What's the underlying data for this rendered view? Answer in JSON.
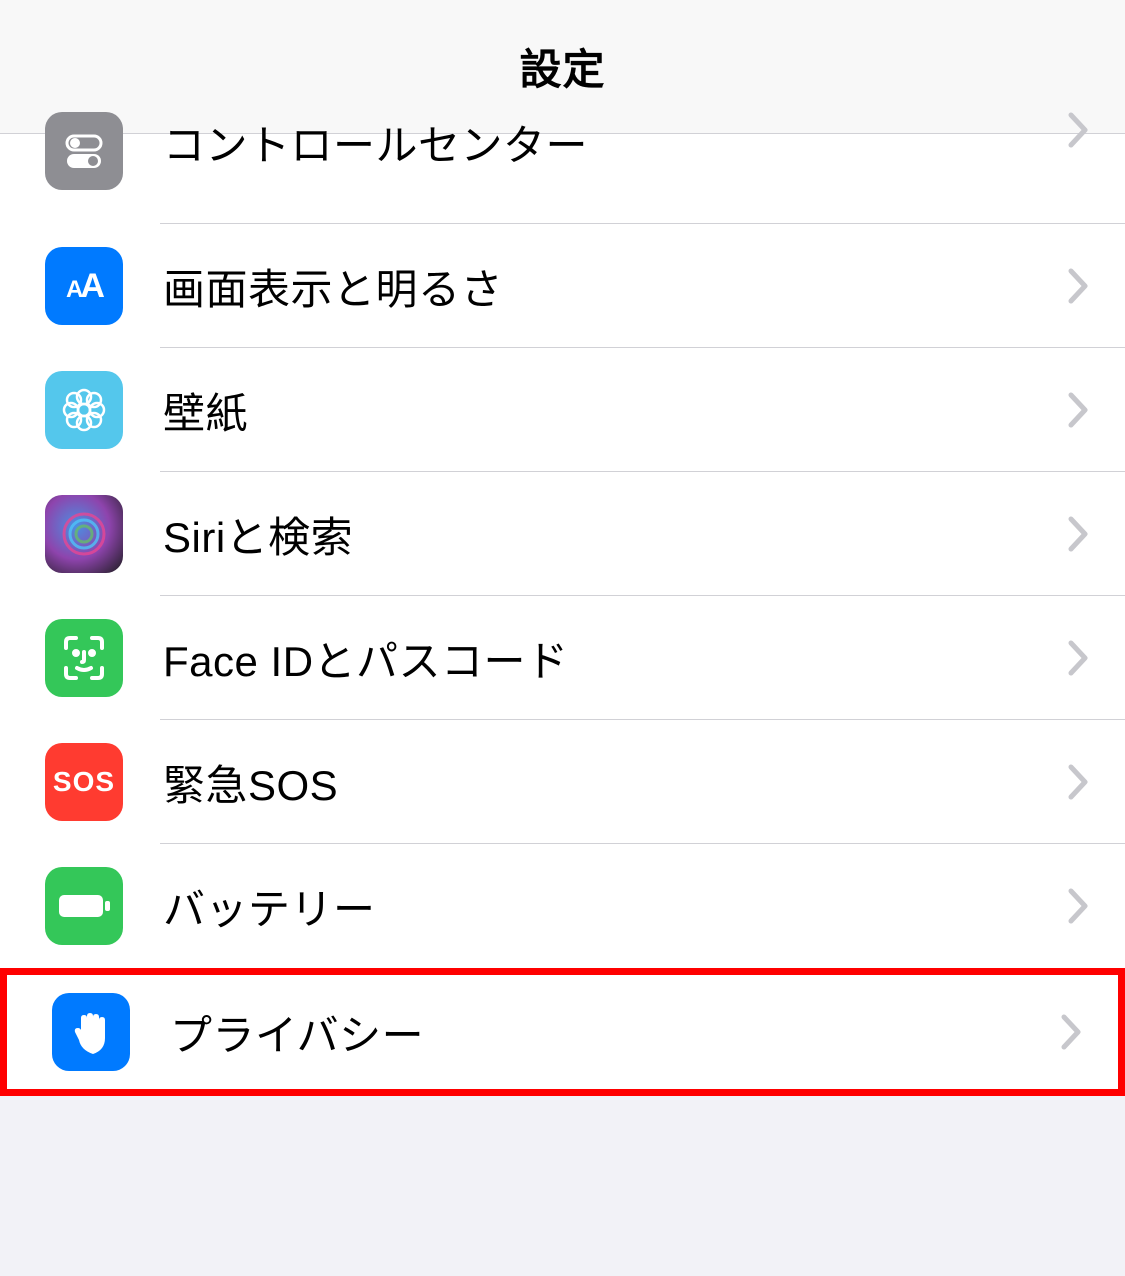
{
  "header": {
    "title": "設定"
  },
  "rows": {
    "control_center": {
      "label": "コントロールセンター",
      "icon_name": "toggles-icon",
      "icon_bg": "#8e8e93"
    },
    "display": {
      "label": "画面表示と明るさ",
      "icon_name": "text-size-icon",
      "icon_bg": "#007aff"
    },
    "wallpaper": {
      "label": "壁紙",
      "icon_name": "flower-icon",
      "icon_bg": "#54c7ec"
    },
    "siri": {
      "label": "Siriと検索",
      "icon_name": "siri-icon",
      "icon_bg": "#1c1c1e"
    },
    "faceid": {
      "label": "Face IDとパスコード",
      "icon_name": "face-id-icon",
      "icon_bg": "#34c759"
    },
    "sos": {
      "label": "緊急SOS",
      "icon_name": "sos-icon",
      "icon_bg": "#ff3b30",
      "icon_text": "SOS"
    },
    "battery": {
      "label": "バッテリー",
      "icon_name": "battery-icon",
      "icon_bg": "#34c759"
    },
    "privacy": {
      "label": "プライバシー",
      "icon_name": "hand-icon",
      "icon_bg": "#007aff"
    }
  },
  "highlighted_row": "privacy"
}
